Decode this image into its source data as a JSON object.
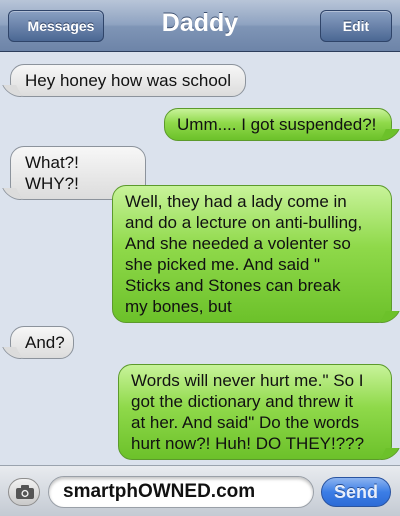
{
  "navbar": {
    "title": "Daddy",
    "back_label": "Messages",
    "edit_label": "Edit"
  },
  "messages": [
    {
      "direction": "incoming",
      "lines": [
        "Hey honey how was school"
      ]
    },
    {
      "direction": "outgoing",
      "lines": [
        "Umm.... I got suspended?!"
      ]
    },
    {
      "direction": "incoming",
      "lines": [
        "What?! WHY?!"
      ]
    },
    {
      "direction": "outgoing",
      "lines": [
        "Well, they had a lady come in",
        "and do a lecture on anti-bulling,",
        "And she needed a volenter so",
        "she picked me. And said \"",
        "Sticks and Stones can break",
        "my bones, but"
      ]
    },
    {
      "direction": "incoming",
      "lines": [
        "And?"
      ]
    },
    {
      "direction": "outgoing",
      "lines": [
        "Words will never hurt me.\" So I",
        "got the dictionary and threw it",
        "at her. And said\" Do the words",
        "hurt now?! Huh! DO THEY!???"
      ]
    }
  ],
  "input_bar": {
    "camera_icon": "camera-icon",
    "field_value": "smartphOWNED.com",
    "send_label": "Send"
  },
  "colors": {
    "background": "#dbe2ed",
    "outgoing_bubble": "#8fd94a",
    "incoming_bubble": "#e9e9e9",
    "nav_bar": "#7f95b6",
    "send_button": "#3c7ee6"
  }
}
